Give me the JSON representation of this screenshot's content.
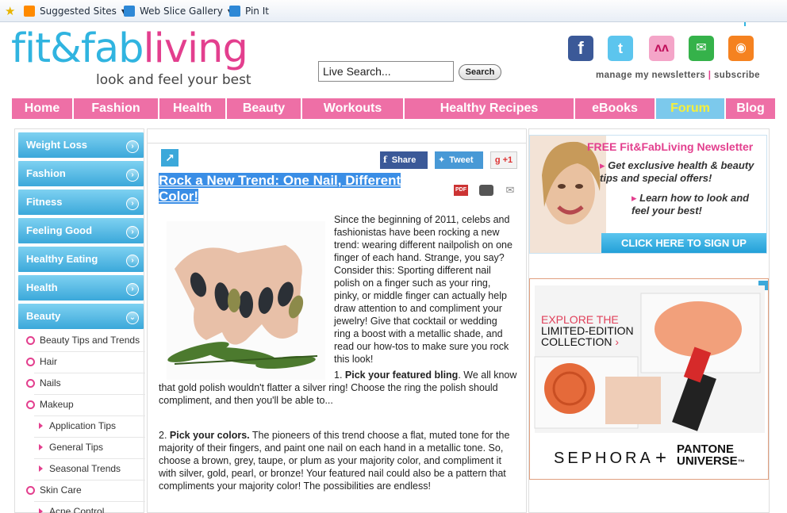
{
  "favorites_bar": {
    "items": [
      {
        "label": "Suggested Sites",
        "icon": "suggested-sites-icon",
        "has_dropdown": true
      },
      {
        "label": "Web Slice Gallery",
        "icon": "web-slice-icon",
        "has_dropdown": true
      },
      {
        "label": "Pin It",
        "icon": "pin-it-icon",
        "has_dropdown": false
      }
    ]
  },
  "header": {
    "logo_part1": "fit&fab",
    "logo_part2": "living",
    "tagline": "look and feel your best",
    "search": {
      "value": "Live Search...",
      "button": "Search"
    },
    "social_icons": [
      "facebook-icon",
      "twitter-icon",
      "myspace-icon",
      "email-icon",
      "rss-icon"
    ],
    "newsletter_link": "manage my newsletters",
    "separator": "|",
    "subscribe_link": "subscribe"
  },
  "nav": {
    "items": [
      "Home",
      "Fashion",
      "Health",
      "Beauty",
      "Workouts",
      "Healthy Recipes",
      "eBooks",
      "Forum",
      "Blog"
    ]
  },
  "sidebar": {
    "categories": [
      {
        "label": "Weight Loss",
        "arrow": "›"
      },
      {
        "label": "Fashion",
        "arrow": "›"
      },
      {
        "label": "Fitness",
        "arrow": "›"
      },
      {
        "label": "Feeling Good",
        "arrow": "›"
      },
      {
        "label": "Healthy Eating",
        "arrow": "›"
      },
      {
        "label": "Health",
        "arrow": "›"
      },
      {
        "label": "Beauty",
        "arrow": "⌄"
      }
    ],
    "beauty_subitems": [
      "Beauty Tips and Trends",
      "Hair",
      "Nails",
      "Makeup"
    ],
    "makeup_subitems": [
      "Application Tips",
      "General Tips",
      "Seasonal Trends"
    ],
    "skin_care": "Skin Care",
    "skin_care_sub": "Acne Control"
  },
  "article": {
    "share": "Share",
    "tweet": "Tweet",
    "gplus": "+1",
    "gplus_g": "g",
    "title": "Rock a New Trend: One Nail, Different Color!",
    "tools": [
      "pdf-icon",
      "print-icon",
      "email-icon"
    ],
    "pdf_label": "PDF",
    "intro": "Since the beginning of 2011, celebs and fashionistas have been rocking a new trend: wearing different nailpolish on one finger of each hand. Strange, you say? Consider this: Sporting different nail polish on a finger such as your ring, pinky, or middle finger can actually help draw attention to and compliment your jewelry! Give that cocktail or wedding ring a boost with a metallic shade, and read our how-tos to make sure you rock this look!",
    "point1_num": "1.",
    "point1_bold": "Pick your featured bling",
    "point1_text": ". We all know that gold polish wouldn't flatter a silver ring! Choose the ring the polish should compliment, and then you'll be able to...",
    "point2_num": "2.",
    "point2_bold": "Pick your colors.",
    "point2_text": " The pioneers of this trend choose a flat, muted tone for the majority of their fingers, and paint one nail on each hand in a metallic tone. So, choose a brown, grey, taupe, or plum as your majority color, and compliment it with silver, gold, pearl, or bronze! Your featured nail could also be a pattern that compliments your majority color! The possibilities are endless!"
  },
  "newsletter_ad": {
    "title_free": "FREE",
    "title_brand": "Fit&FabLiving",
    "title_rest": "Newsletter",
    "line1": "Get exclusive health & beauty tips and special offers!",
    "line2": "Learn how to look and feel your best!",
    "cta": "CLICK HERE TO SIGN UP"
  },
  "sephora_ad": {
    "explore": "EXPLORE THE",
    "limited": "LIMITED-EDITION",
    "collection": "COLLECTION",
    "brand": "SEPHORA",
    "plus": "+",
    "pantone_1": "PANTONE",
    "pantone_2": "UNIVERSE",
    "trademark": "™"
  },
  "colors": {
    "brand_blue": "#30b4e0",
    "brand_pink": "#e33f8e",
    "nav_pink": "#ee6fa6",
    "forum_blue": "#7cc9ec",
    "forum_text": "#f6ef3a"
  }
}
